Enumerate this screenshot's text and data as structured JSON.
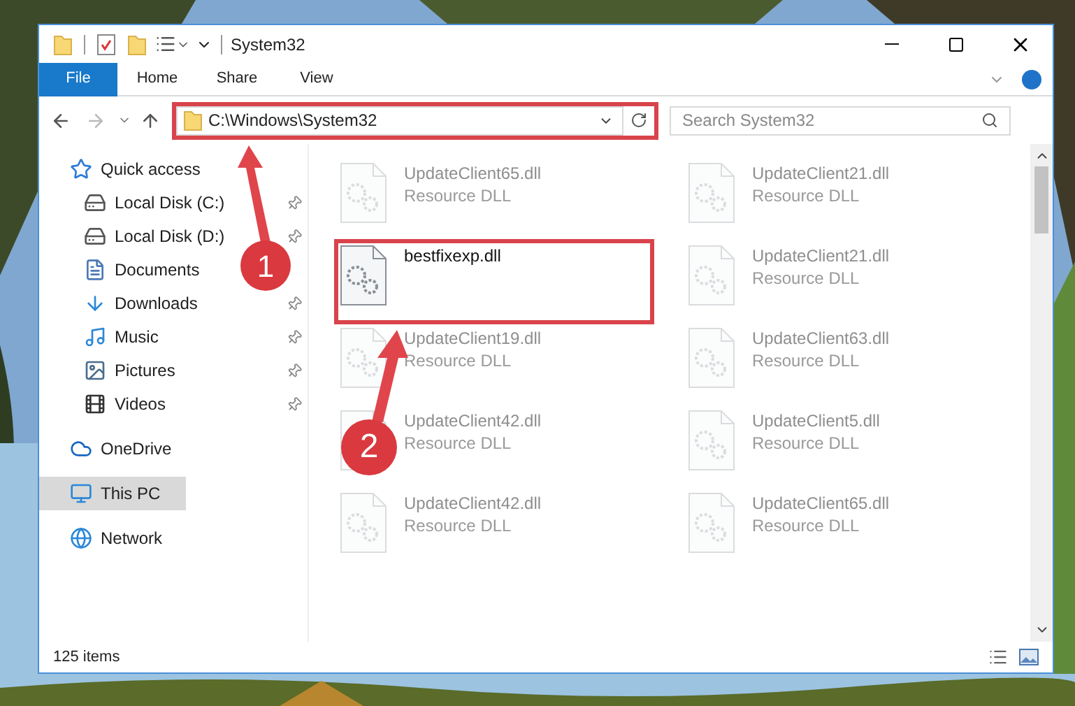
{
  "window": {
    "title": "System32"
  },
  "ribbon_tabs": [
    {
      "label": "File",
      "selected": true
    },
    {
      "label": "Home",
      "selected": false
    },
    {
      "label": "Share",
      "selected": false
    },
    {
      "label": "View",
      "selected": false
    }
  ],
  "address": {
    "path": "C:\\Windows\\System32",
    "highlighted": true
  },
  "search": {
    "placeholder": "Search System32"
  },
  "sidebar": {
    "items": [
      {
        "label": "Quick access",
        "pinned": false,
        "selected": false,
        "children": [
          {
            "label": "Local Disk (C:)",
            "pinned": true,
            "selected": false
          },
          {
            "label": "Local Disk (D:)",
            "pinned": true,
            "selected": false
          },
          {
            "label": "Documents",
            "pinned": false,
            "selected": false
          },
          {
            "label": "Downloads",
            "pinned": true,
            "selected": false
          },
          {
            "label": "Music",
            "pinned": true,
            "selected": false
          },
          {
            "label": "Pictures",
            "pinned": true,
            "selected": false
          },
          {
            "label": "Videos",
            "pinned": true,
            "selected": false
          }
        ]
      },
      {
        "label": "OneDrive",
        "pinned": false,
        "selected": false
      },
      {
        "label": "This PC",
        "pinned": false,
        "selected": true
      },
      {
        "label": "Network",
        "pinned": false,
        "selected": false
      }
    ]
  },
  "files": [
    {
      "name": "UpdateClient65.dll",
      "type": "Resource DLL",
      "dimmed": true,
      "highlighted": false
    },
    {
      "name": "UpdateClient21.dll",
      "type": "Resource DLL",
      "dimmed": true,
      "highlighted": false
    },
    {
      "name": "bestfixexp.dll",
      "dimmed": false,
      "highlighted": true
    },
    {
      "name": "UpdateClient21.dll",
      "type": "Resource DLL",
      "dimmed": true,
      "highlighted": false
    },
    {
      "name": "UpdateClient19.dll",
      "type": "Resource DLL",
      "dimmed": true,
      "highlighted": false
    },
    {
      "name": "UpdateClient63.dll",
      "type": "Resource DLL",
      "dimmed": true,
      "highlighted": false
    },
    {
      "name": "UpdateClient42.dll",
      "type": "Resource DLL",
      "dimmed": true,
      "highlighted": false
    },
    {
      "name": "UpdateClient5.dll",
      "type": "Resource DLL",
      "dimmed": true,
      "highlighted": false
    },
    {
      "name": "UpdateClient42.dll",
      "type": "Resource DLL",
      "dimmed": true,
      "highlighted": false
    },
    {
      "name": "UpdateClient65.dll",
      "type": "Resource DLL",
      "dimmed": true,
      "highlighted": false
    }
  ],
  "status_bar": {
    "count": "125 items"
  },
  "annotations": [
    {
      "number": "1"
    },
    {
      "number": "2"
    }
  ]
}
